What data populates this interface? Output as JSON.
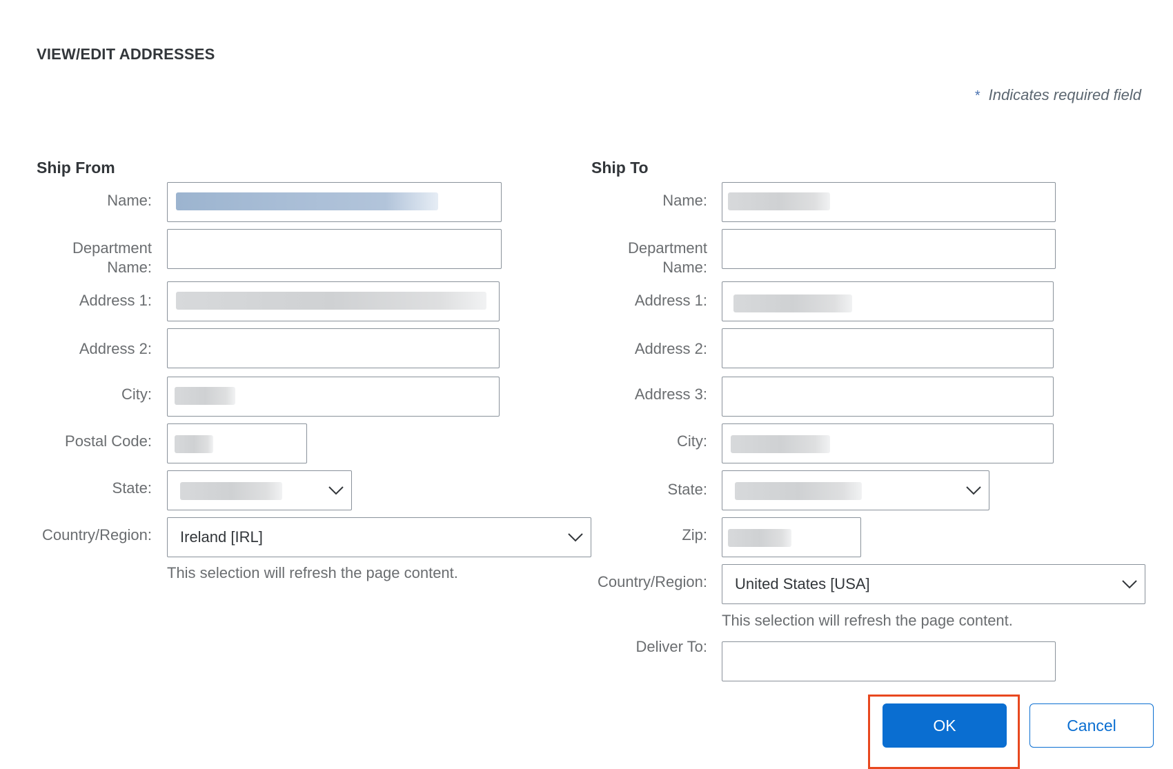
{
  "dialog": {
    "title": "VIEW/EDIT ADDRESSES",
    "required_marker": "*",
    "required_note": "Indicates required field"
  },
  "ship_from": {
    "heading": "Ship From",
    "labels": {
      "name": "Name:",
      "department": "Department Name:",
      "address1": "Address 1:",
      "address2": "Address 2:",
      "city": "City:",
      "postal_code": "Postal Code:",
      "state": "State:",
      "country": "Country/Region:"
    },
    "values": {
      "country": "Ireland  [IRL]"
    },
    "country_hint": "This selection will refresh the page content."
  },
  "ship_to": {
    "heading": "Ship To",
    "labels": {
      "name": "Name:",
      "department": "Department Name:",
      "address1": "Address 1:",
      "address2": "Address 2:",
      "address3": "Address 3:",
      "city": "City:",
      "state": "State:",
      "zip": "Zip:",
      "country": "Country/Region:",
      "deliver_to": "Deliver To:"
    },
    "values": {
      "country": "United States  [USA]"
    },
    "country_hint": "This selection will refresh the page content."
  },
  "actions": {
    "ok_label": "OK",
    "cancel_label": "Cancel"
  },
  "colors": {
    "accent": "#0a6ed1",
    "highlight": "#e8481f"
  },
  "icons": {
    "dropdown": "chevron-down-icon"
  }
}
